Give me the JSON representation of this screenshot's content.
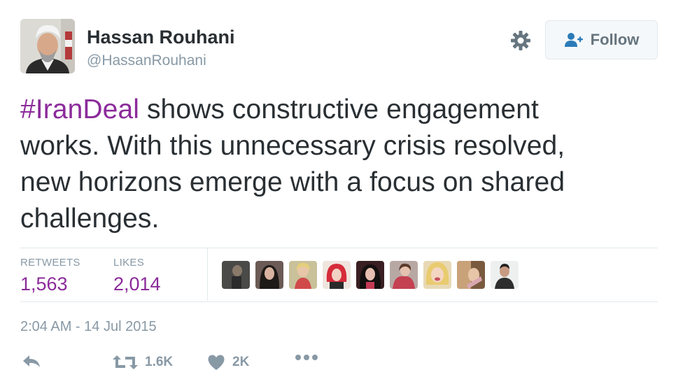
{
  "author": {
    "display_name": "Hassan Rouhani",
    "handle": "@HassanRouhani"
  },
  "follow_button": {
    "label": "Follow"
  },
  "tweet": {
    "hashtag": "#IranDeal",
    "line1_rest": " shows constructive engagement",
    "line2": "works. With this unnecessary crisis resolved,",
    "line3": "new horizons emerge with a focus on shared",
    "line4": "challenges."
  },
  "stats": {
    "retweets_label": "RETWEETS",
    "retweets_value": "1,563",
    "likes_label": "LIKES",
    "likes_value": "2,014"
  },
  "timestamp": "2:04 AM - 14 Jul 2015",
  "actions": {
    "retweet_count": "1.6K",
    "like_count": "2K"
  },
  "colors": {
    "link_purple": "#8b2b9a",
    "muted_gray": "#8899a6",
    "text_dark": "#292f33",
    "divider": "#e1e8ed"
  }
}
